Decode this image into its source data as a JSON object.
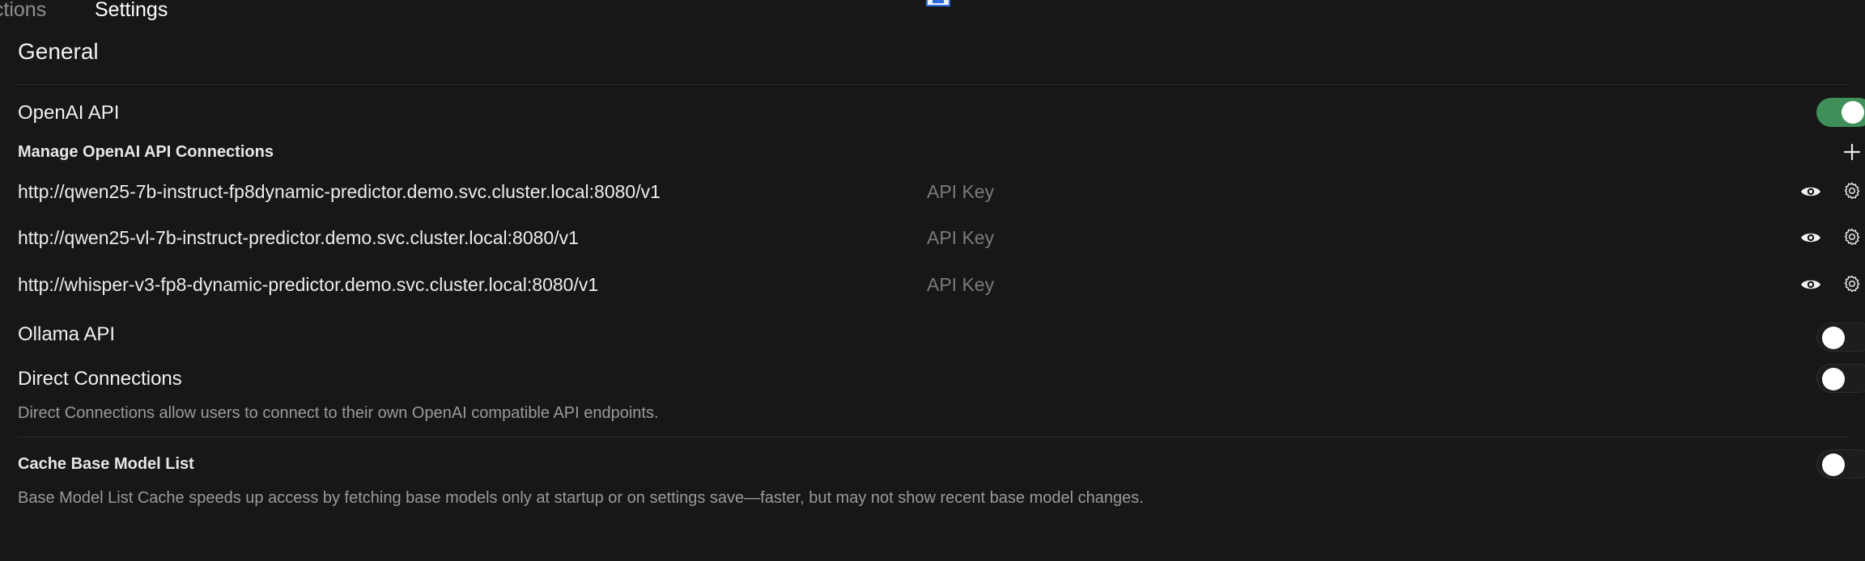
{
  "tabs": {
    "partial": "nctions",
    "active": "Settings"
  },
  "general": {
    "title": "General"
  },
  "openai": {
    "label": "OpenAI API",
    "enabled": true,
    "manage_label": "Manage OpenAI API Connections",
    "add_icon": "plus-icon",
    "connections": [
      {
        "url": "http://qwen25-7b-instruct-fp8dynamic-predictor.demo.svc.cluster.local:8080/v1",
        "key_placeholder": "API Key"
      },
      {
        "url": "http://qwen25-vl-7b-instruct-predictor.demo.svc.cluster.local:8080/v1",
        "key_placeholder": "API Key"
      },
      {
        "url": "http://whisper-v3-fp8-dynamic-predictor.demo.svc.cluster.local:8080/v1",
        "key_placeholder": "API Key"
      }
    ]
  },
  "ollama": {
    "label": "Ollama API",
    "enabled": false
  },
  "direct": {
    "label": "Direct Connections",
    "description": "Direct Connections allow users to connect to their own OpenAI compatible API endpoints.",
    "enabled": false
  },
  "cache": {
    "label": "Cache Base Model List",
    "description": "Base Model List Cache speeds up access by fetching base models only at startup or on settings save—faster, but may not show recent base model changes.",
    "enabled": false
  },
  "colors": {
    "background": "#171717",
    "toggle_on": "#3f8f5b",
    "muted_text": "#9a9a9a"
  }
}
